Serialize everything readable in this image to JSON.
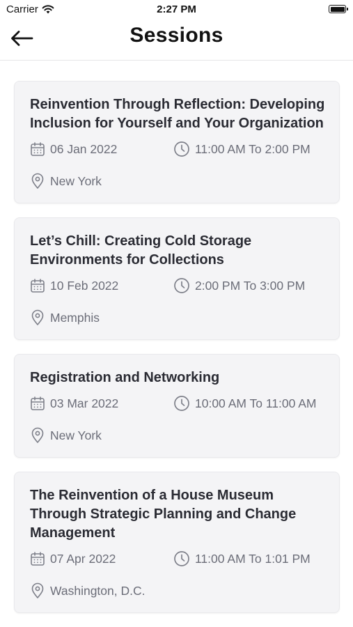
{
  "status_bar": {
    "carrier": "Carrier",
    "time": "2:27 PM"
  },
  "header": {
    "title": "Sessions"
  },
  "sessions": [
    {
      "title_lines": [
        "Reinvention Through Reflection: Developing",
        "Inclusion for Yourself and Your Organization"
      ],
      "date": "06 Jan 2022",
      "time": "11:00 AM To 2:00 PM",
      "location": "New York"
    },
    {
      "title_lines": [
        "Let’s Chill: Creating Cold Storage",
        "Environments for Collections"
      ],
      "date": "10 Feb 2022",
      "time": "2:00 PM To 3:00 PM",
      "location": "Memphis"
    },
    {
      "title_lines": [
        "Registration and Networking"
      ],
      "date": "03 Mar 2022",
      "time": "10:00 AM To 11:00 AM",
      "location": "New York"
    },
    {
      "title_lines": [
        "The Reinvention of a House Museum",
        "Through Strategic Planning and Change",
        "Management"
      ],
      "date": "07 Apr 2022",
      "time": "11:00 AM To 1:01 PM",
      "location": "Washington, D.C."
    }
  ]
}
